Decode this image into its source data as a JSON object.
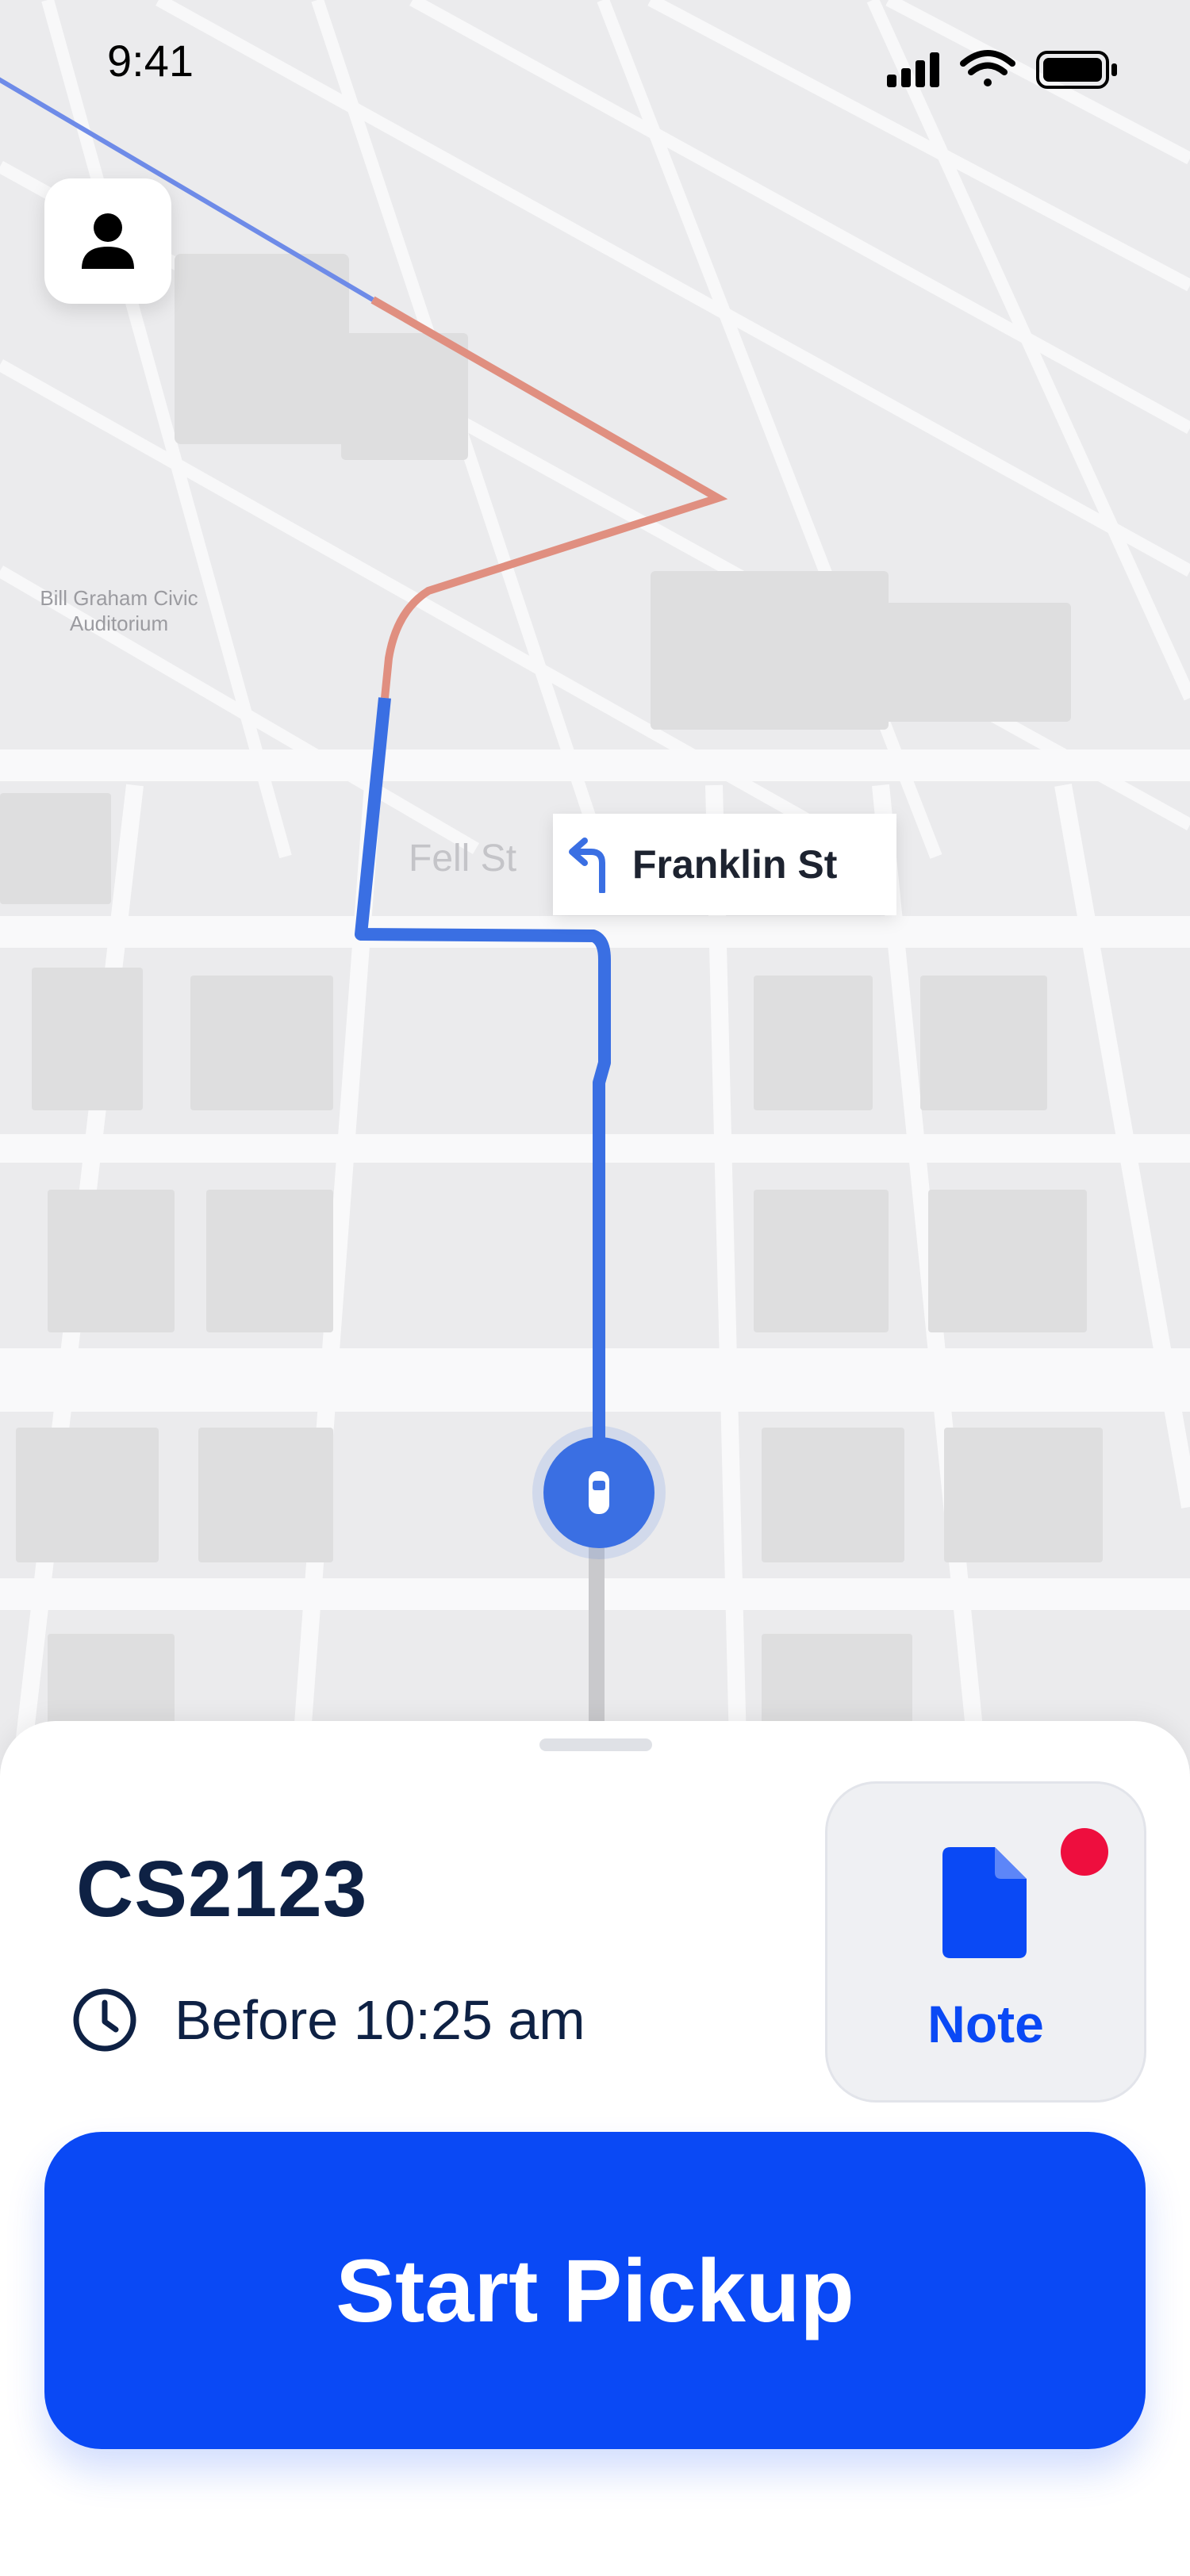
{
  "status_bar": {
    "time": "9:41"
  },
  "map": {
    "turn_instruction": {
      "street": "Franklin St",
      "icon": "turn-left-icon"
    },
    "ghost_street": "Fell St",
    "poi": "Bill Graham Civic Auditorium",
    "route_colors": {
      "active": "#3a6fe3",
      "traffic": "#e08f80",
      "passed": "#6e8be8"
    }
  },
  "profile_button": {
    "icon": "person-icon"
  },
  "sheet": {
    "order_id": "CS2123",
    "deadline": "Before 10:25 am",
    "deadline_icon": "clock-icon",
    "note_button": {
      "label": "Note",
      "icon": "document-icon",
      "has_unread": true
    },
    "primary_action": "Start Pickup"
  },
  "colors": {
    "accent": "#0a49f5",
    "text_dark": "#0e2144",
    "badge_red": "#ee0e3e"
  }
}
